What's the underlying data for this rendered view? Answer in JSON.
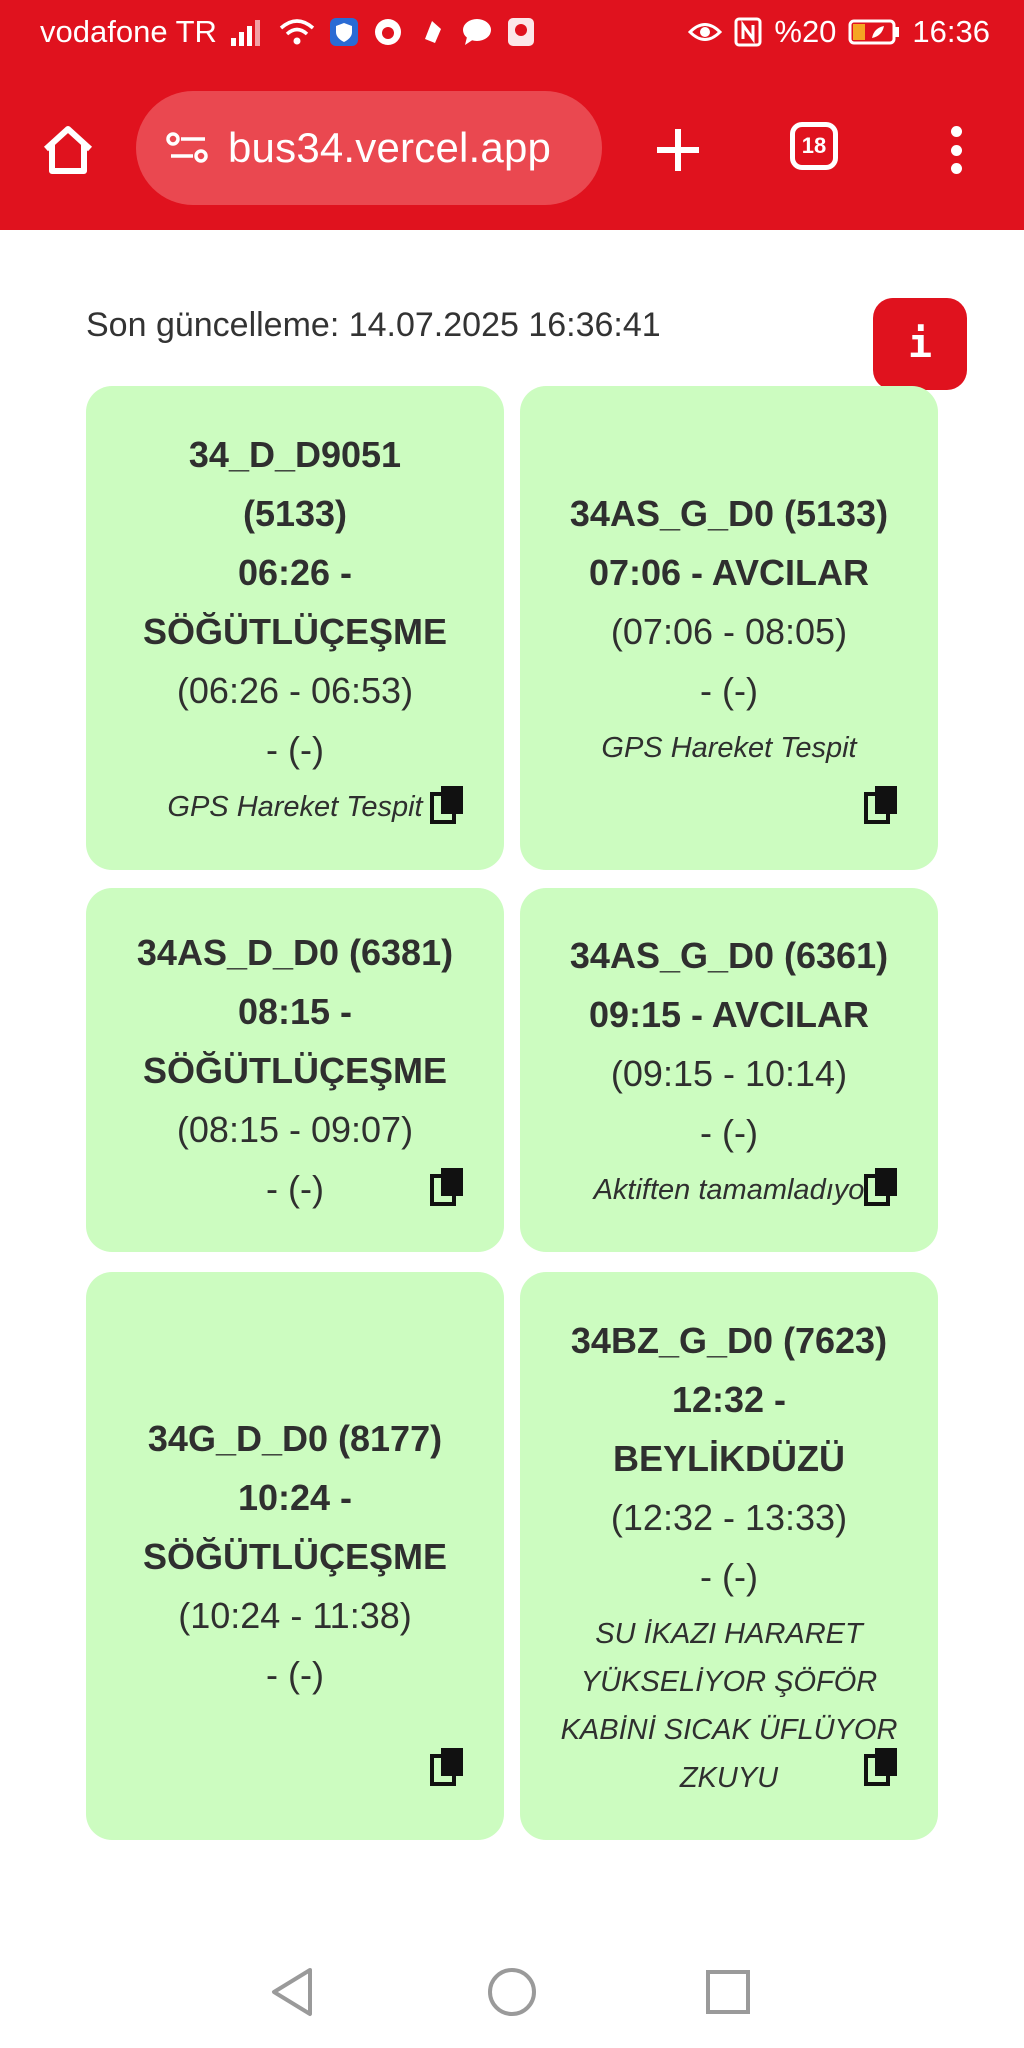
{
  "status_bar": {
    "carrier": "vodafone TR",
    "battery": "%20",
    "time": "16:36"
  },
  "browser": {
    "url": "bus34.vercel.app",
    "tab_count": "18"
  },
  "page": {
    "last_update": "Son güncelleme: 14.07.2025 16:36:41",
    "info_label": "i"
  },
  "cards": [
    {
      "title": [
        "34_D_D9051",
        "(5133)",
        "06:26 -",
        "SÖĞÜTLÜÇEŞME"
      ],
      "time_range": "(06:26 - 06:53)",
      "extra": "- (-)",
      "note": [
        "GPS Hareket Tespit"
      ]
    },
    {
      "title": [
        "34AS_G_D0 (5133)",
        "07:06 - AVCILAR"
      ],
      "time_range": "(07:06 - 08:05)",
      "extra": "- (-)",
      "note": [
        "GPS Hareket Tespit"
      ]
    },
    {
      "title": [
        "34AS_D_D0 (6381)",
        "08:15 -",
        "SÖĞÜTLÜÇEŞME"
      ],
      "time_range": "(08:15 - 09:07)",
      "extra": "- (-)",
      "note": []
    },
    {
      "title": [
        "34AS_G_D0 (6361)",
        "09:15 - AVCILAR"
      ],
      "time_range": "(09:15 - 10:14)",
      "extra": "- (-)",
      "note": [
        "Aktiften tamamladıyo"
      ]
    },
    {
      "title": [
        "34G_D_D0 (8177)",
        "10:24 -",
        "SÖĞÜTLÜÇEŞME"
      ],
      "time_range": "(10:24 - 11:38)",
      "extra": "- (-)",
      "note": []
    },
    {
      "title": [
        "34BZ_G_D0 (7623)",
        "12:32 -",
        "BEYLİKDÜZÜ"
      ],
      "time_range": "(12:32 - 13:33)",
      "extra": "- (-)",
      "note": [
        "SU İKAZI HARARET",
        "YÜKSELİYOR ŞÖFÖR",
        "KABİNİ SICAK ÜFLÜYOR",
        "ZKUYU"
      ]
    }
  ],
  "colors": {
    "brand_red": "#e0121e",
    "url_pill": "#ea4850",
    "card_bg": "#ccfcc0",
    "text": "#2f2f2f"
  }
}
